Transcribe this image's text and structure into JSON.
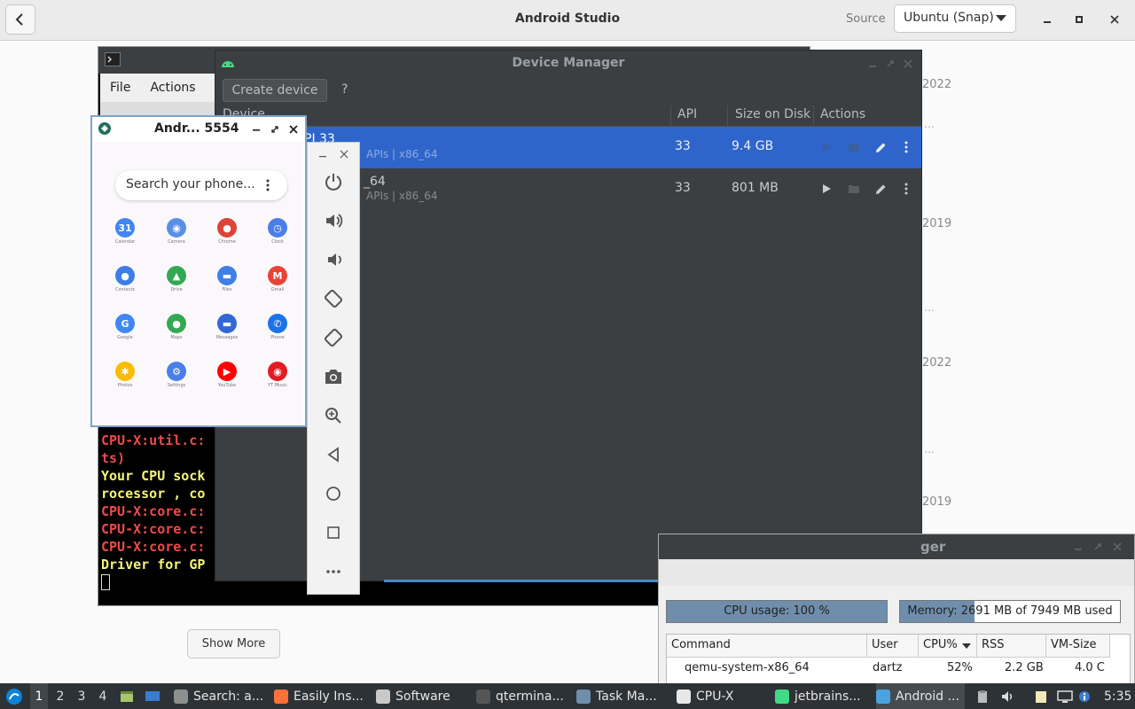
{
  "software": {
    "title": "Android Studio",
    "source_label": "Source",
    "source_value": "Ubuntu (Snap)",
    "years": [
      "2022",
      "2019",
      "2022",
      "2019"
    ],
    "show_more": "Show More"
  },
  "terminal": {
    "menu": [
      "File",
      "Actions"
    ],
    "lines": [
      {
        "text": "CPU-X:util.c:",
        "color": "red"
      },
      {
        "text": "ts)",
        "color": "red"
      },
      {
        "text": "Your CPU sock",
        "color": "yellow"
      },
      {
        "text": "rocessor , co",
        "color": "yellow"
      },
      {
        "text": "CPU-X:core.c:",
        "color": "red"
      },
      {
        "text": "CPU-X:core.c:",
        "color": "red"
      },
      {
        "text": "CPU-X:core.c:",
        "color": "red"
      },
      {
        "text": "Driver for GP",
        "color": "yellow"
      }
    ]
  },
  "device_manager": {
    "title": "Device Manager",
    "create_device": "Create device",
    "help": "?",
    "columns": {
      "device": "Device",
      "api": "API",
      "size": "Size on Disk",
      "actions": "Actions"
    },
    "rows": [
      {
        "name": "PI 33",
        "sub": "APIs | x86_64",
        "api": "33",
        "size": "9.4 GB",
        "selected": true
      },
      {
        "name": "_64",
        "sub": "APIs | x86_64",
        "api": "33",
        "size": "801 MB",
        "selected": false
      }
    ]
  },
  "emulator": {
    "title": "Andr... 5554",
    "search_placeholder": "Search your phone...",
    "apps": [
      {
        "name": "Calendar",
        "color": "#4285f4",
        "glyph": "31"
      },
      {
        "name": "Camera",
        "color": "#5b8fe6",
        "glyph": "◉"
      },
      {
        "name": "Chrome",
        "color": "#db4437",
        "glyph": "●"
      },
      {
        "name": "Clock",
        "color": "#4a7ee8",
        "glyph": "◷"
      },
      {
        "name": "Contacts",
        "color": "#3d7ee6",
        "glyph": "●"
      },
      {
        "name": "Drive",
        "color": "#34a853",
        "glyph": "▲"
      },
      {
        "name": "Files",
        "color": "#3f7fe6",
        "glyph": "▬"
      },
      {
        "name": "Gmail",
        "color": "#ea4335",
        "glyph": "M"
      },
      {
        "name": "Google",
        "color": "#4285f4",
        "glyph": "G"
      },
      {
        "name": "Maps",
        "color": "#34a853",
        "glyph": "●"
      },
      {
        "name": "Messages",
        "color": "#3367d6",
        "glyph": "▬"
      },
      {
        "name": "Phone",
        "color": "#1a73e8",
        "glyph": "✆"
      },
      {
        "name": "Photos",
        "color": "#fbbc05",
        "glyph": "✱"
      },
      {
        "name": "Settings",
        "color": "#4a7ee8",
        "glyph": "⚙"
      },
      {
        "name": "YouTube",
        "color": "#ff0000",
        "glyph": "▶"
      },
      {
        "name": "YT Music",
        "color": "#e31b23",
        "glyph": "◉"
      }
    ]
  },
  "task_manager": {
    "title_partial": "ger",
    "cpu_label": "CPU usage: 100 %",
    "cpu_fraction": 1.0,
    "memory_label": "Memory: 2691 MB of 7949 MB used",
    "memory_fraction": 0.3385,
    "columns": [
      "Command",
      "User",
      "CPU%",
      "RSS",
      "VM-Size"
    ],
    "row": {
      "command": "qemu-system-x86_64",
      "user": "dartz",
      "cpu": "52%",
      "rss": "2.2 GB",
      "vm": "4.0 C"
    }
  },
  "taskbar": {
    "workspaces": [
      "1",
      "2",
      "3",
      "4"
    ],
    "items": [
      {
        "label": "Search: a...",
        "color": "#8f8f8f"
      },
      {
        "label": "Easily Ins...",
        "color": "#ff7139"
      },
      {
        "label": "Software",
        "color": "#c9c9c9"
      },
      {
        "label": "qtermina...",
        "color": "#555555"
      },
      {
        "label": "Task Ma...",
        "color": "#6f8eab"
      },
      {
        "label": "CPU-X",
        "color": "#e8e8e8"
      },
      {
        "label": "jetbrains...",
        "color": "#3ddc84"
      },
      {
        "label": "Android ...",
        "color": "#4aa3df"
      }
    ],
    "clock": "5:35"
  }
}
